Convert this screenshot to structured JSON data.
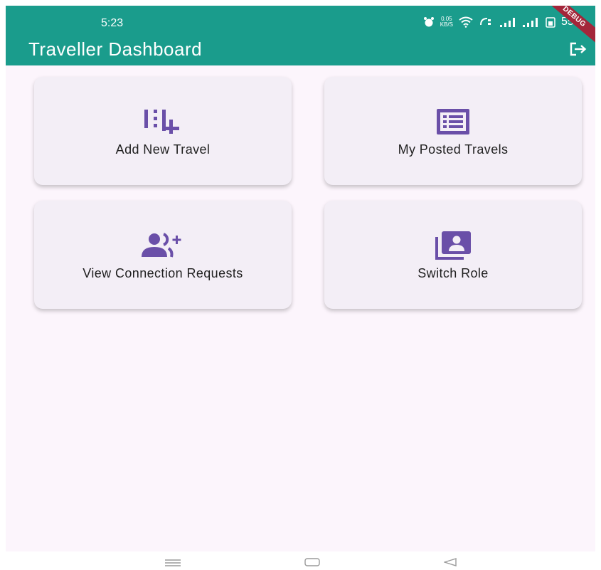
{
  "status_bar": {
    "time": "5:23",
    "net_speed_value": "0.05",
    "net_speed_unit": "KB/S",
    "battery": "55%",
    "debug_banner": "DEBUG"
  },
  "app_bar": {
    "title": "Traveller Dashboard",
    "action_icon": "logout-icon"
  },
  "dashboard": {
    "cards": [
      {
        "label": "Add New Travel",
        "icon": "playlist-add-icon"
      },
      {
        "label": "My Posted Travels",
        "icon": "list-alt-icon"
      },
      {
        "label": "View Connection Requests",
        "icon": "group-add-icon"
      },
      {
        "label": "Switch Role",
        "icon": "switch-account-icon"
      }
    ]
  },
  "system_nav": {
    "buttons": [
      "menu-icon",
      "home-icon",
      "back-icon"
    ]
  },
  "colors": {
    "app_bar": "#1a9c8c",
    "icon_accent": "#6a4fa8",
    "card_background": "#f3eef6",
    "page_background": "#fcf5fc"
  }
}
